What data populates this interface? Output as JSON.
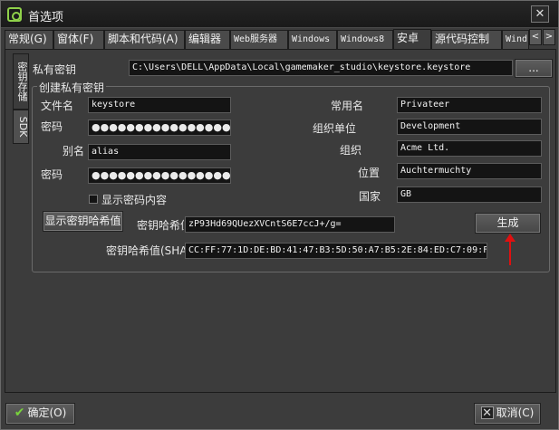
{
  "window": {
    "title": "首选项",
    "close_label": "✕"
  },
  "tabs": [
    {
      "label": "常规(G)"
    },
    {
      "label": "窗体(F)"
    },
    {
      "label": "脚本和代码(A)"
    },
    {
      "label": "编辑器"
    },
    {
      "label": "Web服务器"
    },
    {
      "label": "Windows"
    },
    {
      "label": "Windows8"
    },
    {
      "label": "安卓"
    },
    {
      "label": "源代码控制"
    },
    {
      "label": "Wind"
    }
  ],
  "tab_scroll": {
    "left": "<",
    "right": ">"
  },
  "active_tab": "安卓",
  "side_tabs": [
    {
      "label": "密钥存储"
    },
    {
      "label": "SDK"
    }
  ],
  "keystore": {
    "private_key_label": "私有密钥",
    "private_key_path": "C:\\Users\\DELL\\AppData\\Local\\gamemaker_studio\\keystore.keystore",
    "browse_label": "..."
  },
  "create_group": {
    "title": "创建私有密钥",
    "filename_label": "文件名",
    "filename_value": "keystore",
    "password_label": "密码",
    "password_value": "●●●●●●●●●●●●●●●●",
    "alias_label": "别名",
    "alias_value": "alias",
    "password2_label": "密码",
    "password2_value": "●●●●●●●●●●●●●●●●",
    "show_password_label": "显示密码内容",
    "common_name_label": "常用名",
    "common_name_value": "Privateer",
    "org_unit_label": "组织单位",
    "org_unit_value": "Development",
    "org_label": "组织",
    "org_value": "Acme Ltd.",
    "location_label": "位置",
    "location_value": "Auchtermuchty",
    "country_label": "国家",
    "country_value": "GB",
    "show_hash_button": "显示密钥哈希值",
    "hash_label": "密钥哈希值",
    "hash_value": "zP93Hd69QUezXVCntS6E7ccJ+/g=",
    "generate_button": "生成",
    "sha_label": "密钥哈希值(SHA",
    "sha_value": "CC:FF:77:1D:DE:BD:41:47:B3:5D:50:A7:B5:2E:84:ED:C7:09:F"
  },
  "footer": {
    "ok_label": "确定(O)",
    "cancel_label": "取消(C)"
  },
  "colors": {
    "accent_green": "#78d23c",
    "annotation_red": "#e01010"
  }
}
